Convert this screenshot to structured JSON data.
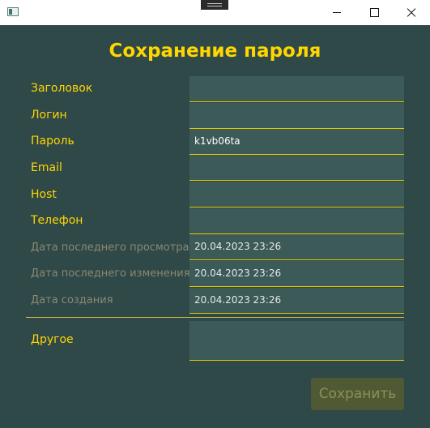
{
  "window": {
    "app_icon": "window-app-icon",
    "minimize_icon": "minimize-icon",
    "maximize_icon": "maximize-icon",
    "close_icon": "close-icon"
  },
  "form": {
    "title": "Сохранение пароля",
    "fields": {
      "title": {
        "label": "Заголовок",
        "value": ""
      },
      "login": {
        "label": "Логин",
        "value": ""
      },
      "password": {
        "label": "Пароль",
        "value": "k1vb06ta"
      },
      "email": {
        "label": "Email",
        "value": ""
      },
      "host": {
        "label": "Host",
        "value": ""
      },
      "phone": {
        "label": "Телефон",
        "value": ""
      },
      "last_viewed": {
        "label": "Дата последнего просмотра",
        "value": "20.04.2023 23:26"
      },
      "last_modified": {
        "label": "Дата последнего изменения",
        "value": "20.04.2023 23:26"
      },
      "created": {
        "label": "Дата создания",
        "value": "20.04.2023 23:26"
      },
      "other": {
        "label": "Другое",
        "value": ""
      }
    },
    "save_label": "Сохранить"
  },
  "colors": {
    "background": "#2f4848",
    "accent": "#ffd700",
    "field_bg": "#3b5a58"
  }
}
